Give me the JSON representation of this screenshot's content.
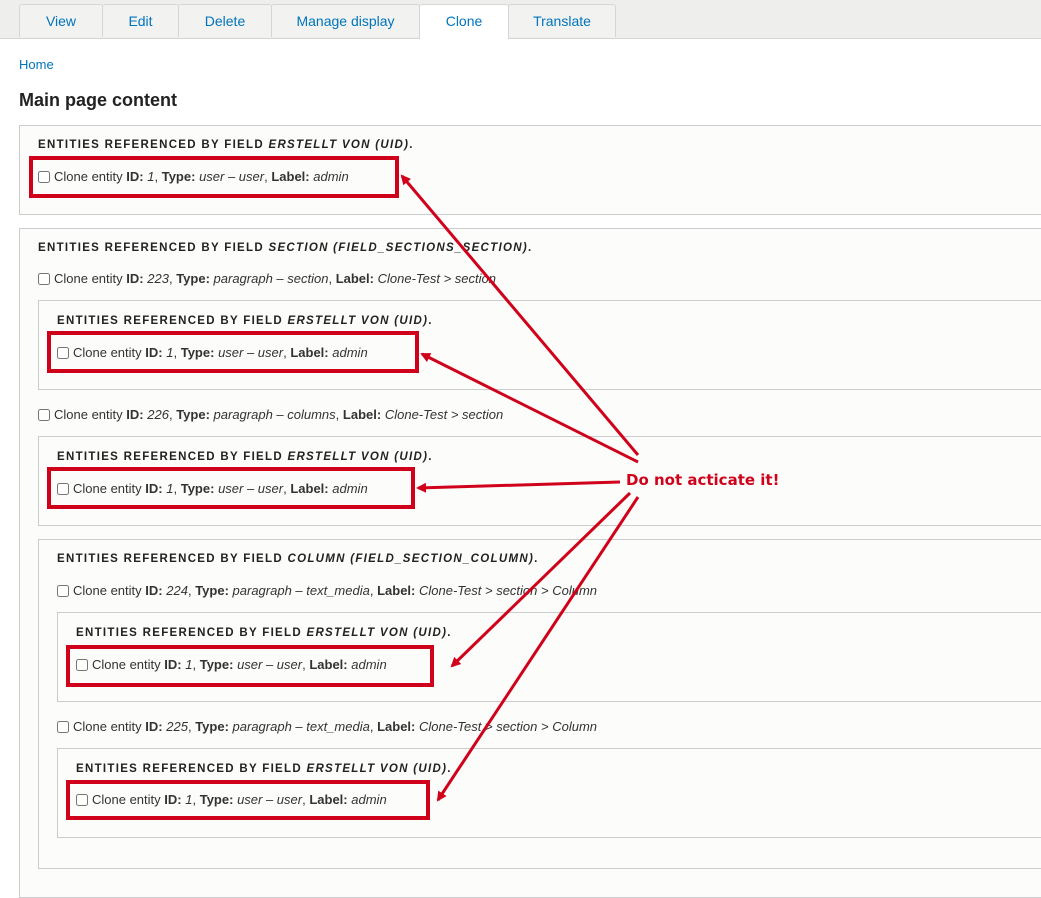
{
  "tabs": [
    "View",
    "Edit",
    "Delete",
    "Manage display",
    "Clone",
    "Translate"
  ],
  "active_tab": "Clone",
  "breadcrumb": "Home",
  "page_title": "Main page content",
  "labels": {
    "prefix": "ENTITIES REFERENCED BY FIELD",
    "clone_entity": "Clone entity",
    "id": "ID:",
    "type": "Type:",
    "label": "Label:"
  },
  "fields": {
    "uid": "ERSTELLT VON (UID)",
    "sections": "SECTION (FIELD_SECTIONS_SECTION)",
    "column": "COLUMN (FIELD_SECTION_COLUMN)"
  },
  "entities": {
    "admin": {
      "id": "1",
      "type": "user – user",
      "label": "admin"
    },
    "e223": {
      "id": "223",
      "type": "paragraph – section",
      "label": "Clone-Test > section"
    },
    "e226": {
      "id": "226",
      "type": "paragraph – columns",
      "label": "Clone-Test > section"
    },
    "e224": {
      "id": "224",
      "type": "paragraph – text_media",
      "label": "Clone-Test > section > Column"
    },
    "e225": {
      "id": "225",
      "type": "paragraph – text_media",
      "label": "Clone-Test > section > Column"
    }
  },
  "annotation": {
    "text": "Do not acticate it!",
    "color": "#d0021b"
  }
}
